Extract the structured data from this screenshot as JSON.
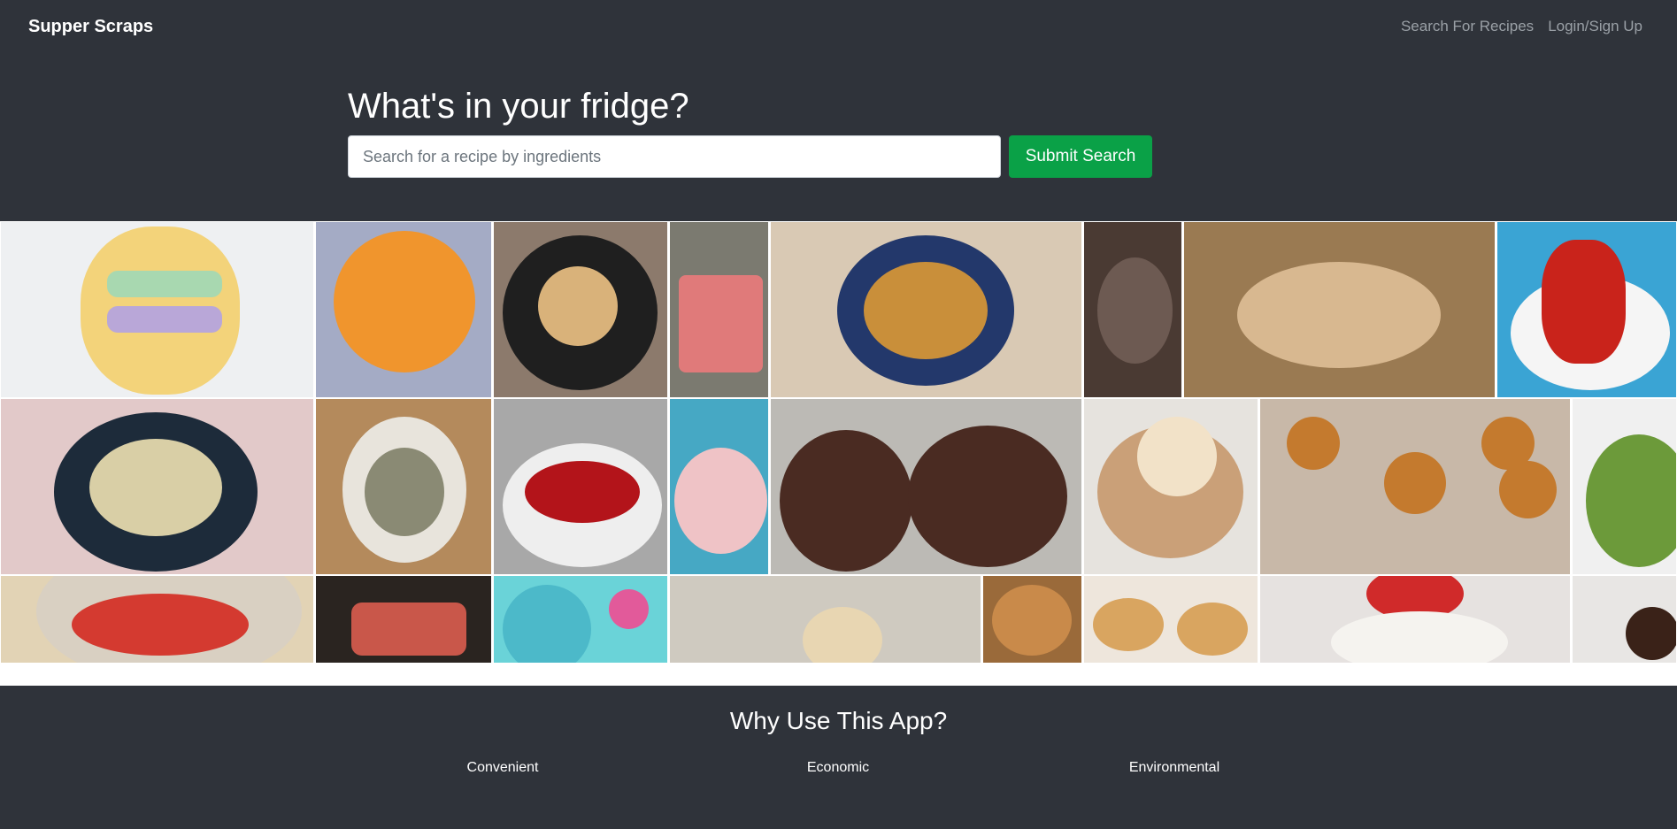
{
  "navbar": {
    "brand": "Supper Scraps",
    "links": [
      "Search For Recipes",
      "Login/Sign Up"
    ]
  },
  "hero": {
    "title": "What's in your fridge?",
    "search_placeholder": "Search for a recipe by ingredients",
    "submit_label": "Submit Search"
  },
  "footer": {
    "title": "Why Use This App?",
    "features": [
      "Convenient",
      "Economic",
      "Environmental"
    ]
  },
  "colors": {
    "nav_bg": "#2f333a",
    "submit_green": "#0aa147",
    "link_gray": "#9aa0a6"
  }
}
